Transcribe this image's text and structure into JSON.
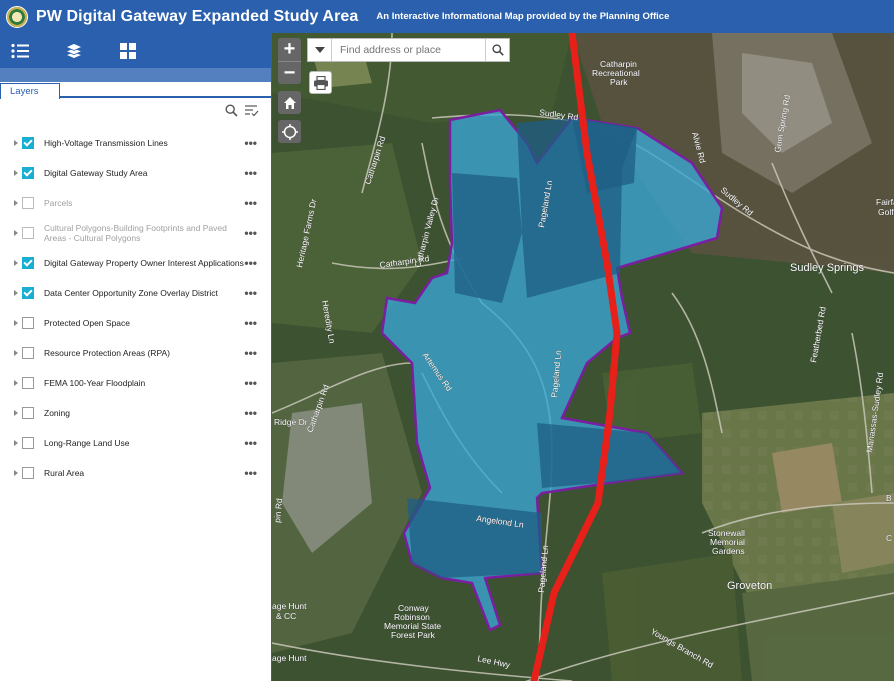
{
  "header": {
    "title": "PW Digital Gateway Expanded Study Area",
    "subtitle": "An Interactive Informational Map provided by the Planning Office"
  },
  "toolbar": {
    "icons": [
      "legend-icon",
      "layer-list-icon",
      "basemap-gallery-icon"
    ]
  },
  "tabs": [
    {
      "label": "Layers"
    }
  ],
  "layers": [
    {
      "name": "High-Voltage Transmission Lines",
      "checked": true,
      "dimmed": false
    },
    {
      "name": "Digital Gateway Study Area",
      "checked": true,
      "dimmed": false
    },
    {
      "name": "Parcels",
      "checked": false,
      "dimmed": true
    },
    {
      "name": "Cultural Polygons-Building Footprints and Paved Areas - Cultural Polygons",
      "checked": false,
      "dimmed": true
    },
    {
      "name": "Digital Gateway Property Owner Interest Applications",
      "checked": true,
      "dimmed": false
    },
    {
      "name": "Data Center Opportunity Zone Overlay District",
      "checked": true,
      "dimmed": false
    },
    {
      "name": "Protected Open Space",
      "checked": false,
      "dimmed": false
    },
    {
      "name": "Resource Protection Areas (RPA)",
      "checked": false,
      "dimmed": false
    },
    {
      "name": "FEMA 100-Year Floodplain",
      "checked": false,
      "dimmed": false
    },
    {
      "name": "Zoning",
      "checked": false,
      "dimmed": false
    },
    {
      "name": "Long-Range Land Use",
      "checked": false,
      "dimmed": false
    },
    {
      "name": "Rural Area",
      "checked": false,
      "dimmed": false
    }
  ],
  "search": {
    "placeholder": "Find address or place"
  },
  "map": {
    "zoom_in": "+",
    "zoom_out": "−",
    "labels": {
      "catharpin_park_1": "Catharpin",
      "catharpin_park_2": "Recreational",
      "catharpin_park_3": "Park",
      "sudley_rd_top": "Sudley Rd",
      "sudley_rd_right": "Sudley Rd",
      "catharpin_rd_top": "Catharpin Rd",
      "catharpin_rd_left": "Catharpin Rd",
      "catharpin_valley": "Catharpin Valley Dr",
      "heritage_farms": "Heritage Farms Dr",
      "heredity": "Heredity Ln",
      "pageland_1": "Pageland Ln",
      "pageland_2": "Pageland Ln",
      "pageland_3": "Pageland Ln",
      "artemus": "Artemus Rd",
      "angelond": "Angelond Ln",
      "ridge": "Ridge Dr",
      "alvie": "Alvie Rd",
      "gum_spring": "Gum Spring Rd",
      "featherbed": "Featherbed Rd",
      "manassas_sudley": "Manassas-Sudley Rd",
      "sudley_springs": "Sudley Springs",
      "fairfax": "Fairfax",
      "golf": "Golf",
      "stonewall_1": "Stonewall",
      "stonewall_2": "Memorial",
      "stonewall_3": "Gardens",
      "groveton": "Groveton",
      "conway_1": "Conway",
      "conway_2": "Robinson",
      "conway_3": "Memorial State",
      "conway_4": "Forest Park",
      "youngs_branch": "Youngs Branch Rd",
      "lee_hwy": "Lee Hwy",
      "hunt_1": "age Hunt",
      "hunt_2": "& CC",
      "hunt_3": "age Hunt",
      "pin_rd": "pin Rd",
      "letter_b": "B",
      "letter_c": "C"
    }
  },
  "colors": {
    "header": "#2a60ad",
    "study_area_fill": "#3aa7d6",
    "study_area_dark": "#1f5d86",
    "study_area_outline": "#7b1fa2",
    "transmission_line": "#e8201a"
  }
}
